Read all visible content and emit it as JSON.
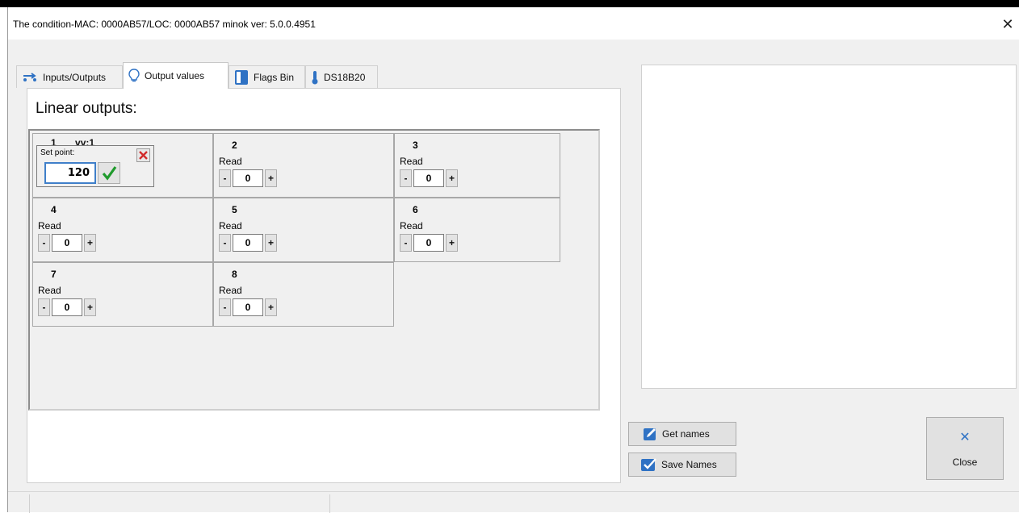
{
  "window": {
    "title": "The condition-MAC: 0000AB57/LOC: 0000AB57 minok ver: 5.0.0.4951",
    "close_glyph": "✕"
  },
  "tabs": [
    {
      "label": "Inputs/Outputs",
      "icon": "io-arrows-icon",
      "active": false
    },
    {
      "label": "Output values",
      "icon": "lightbulb-icon",
      "active": true
    },
    {
      "label": "Flags Bin",
      "icon": "flag-panel-icon",
      "active": false
    },
    {
      "label": "DS18B20",
      "icon": "thermometer-icon",
      "active": false
    }
  ],
  "section_title": "Linear outputs:",
  "outputs": [
    {
      "num": "1",
      "name": "vv:1"
    },
    {
      "num": "2",
      "status": "Read",
      "value": "0"
    },
    {
      "num": "3",
      "status": "Read",
      "value": "0"
    },
    {
      "num": "4",
      "status": "Read",
      "value": "0"
    },
    {
      "num": "5",
      "status": "Read",
      "value": "0"
    },
    {
      "num": "6",
      "status": "Read",
      "value": "0"
    },
    {
      "num": "7",
      "status": "Read",
      "value": "0"
    },
    {
      "num": "8",
      "status": "Read",
      "value": "0"
    }
  ],
  "stepper": {
    "minus": "-",
    "plus": "+"
  },
  "setpoint": {
    "label": "Set point:",
    "value": "120"
  },
  "buttons": {
    "get_names": "Get names",
    "save_names": "Save Names",
    "close": "Close",
    "close_glyph": "✕"
  },
  "colors": {
    "accent": "#2f72c4",
    "ok_green": "#1f9a2c",
    "cancel_red": "#d12a2a"
  }
}
